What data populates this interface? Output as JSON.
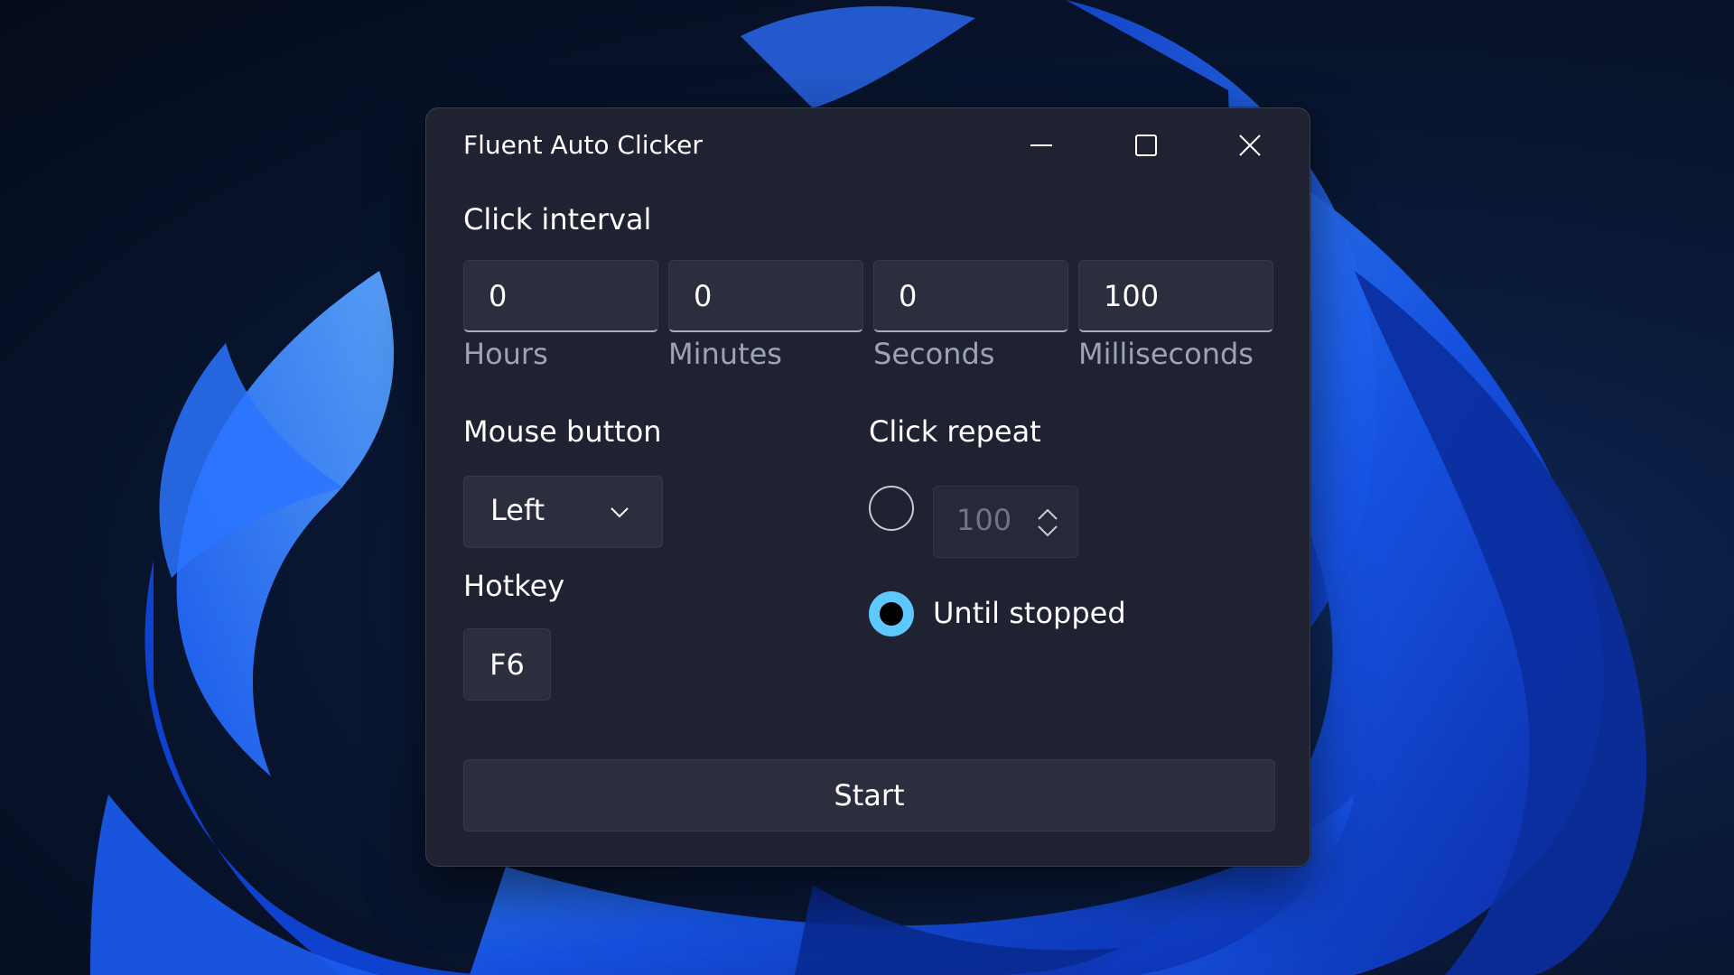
{
  "window": {
    "title": "Fluent Auto Clicker"
  },
  "interval": {
    "label": "Click interval",
    "fields": [
      {
        "value": "0",
        "caption": "Hours"
      },
      {
        "value": "0",
        "caption": "Minutes"
      },
      {
        "value": "0",
        "caption": "Seconds"
      },
      {
        "value": "100",
        "caption": "Milliseconds"
      }
    ]
  },
  "mouse_button": {
    "label": "Mouse button",
    "selected": "Left"
  },
  "hotkey": {
    "label": "Hotkey",
    "value": "F6"
  },
  "click_repeat": {
    "label": "Click repeat",
    "count_value": "100",
    "count_selected": false,
    "until_stopped_label": "Until stopped",
    "until_stopped_selected": true
  },
  "actions": {
    "start_label": "Start"
  },
  "colors": {
    "accent": "#5cc8ff",
    "window_bg": "#1e2231",
    "control_bg": "#2a2e3d",
    "caption_text": "#9ea3b2"
  },
  "icons": {
    "minimize": "minimize-icon",
    "maximize": "maximize-icon",
    "close": "close-icon",
    "dropdown": "chevron-down-icon",
    "spinner": "spinner-updown-icon"
  }
}
